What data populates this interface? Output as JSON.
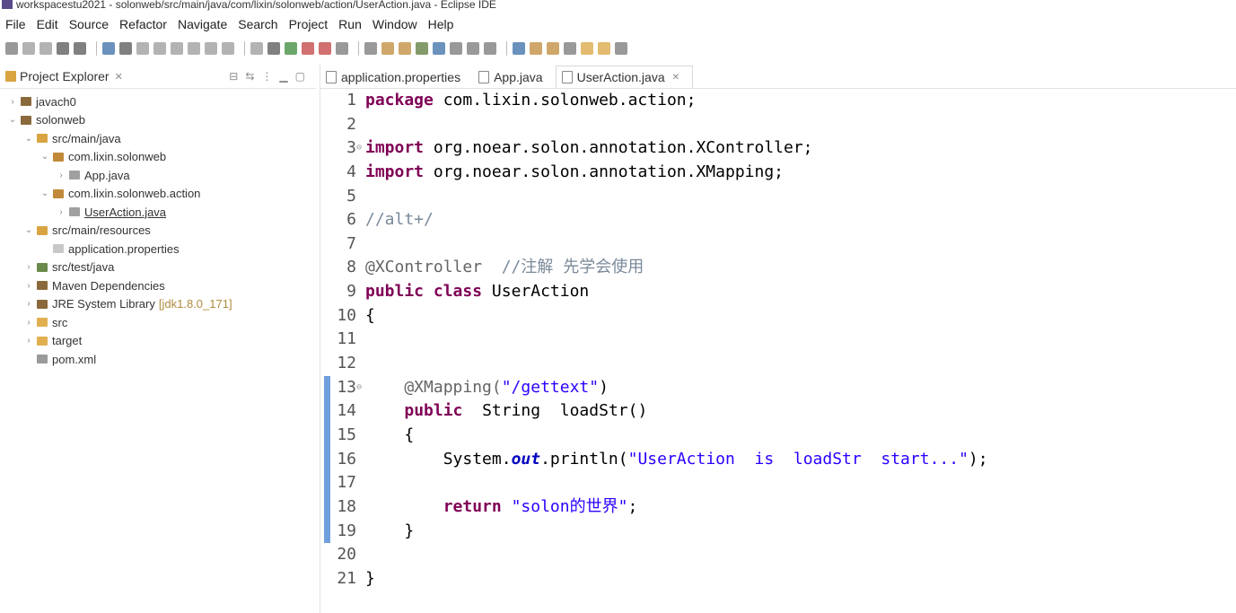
{
  "window": {
    "title": "workspacestu2021 - solonweb/src/main/java/com/lixin/solonweb/action/UserAction.java - Eclipse IDE"
  },
  "menu": [
    "File",
    "Edit",
    "Source",
    "Refactor",
    "Navigate",
    "Search",
    "Project",
    "Run",
    "Window",
    "Help"
  ],
  "explorer": {
    "title": "Project Explorer",
    "close_glyph": "✕",
    "tree": [
      {
        "label": "javach0",
        "indent": 0,
        "arrow": "›",
        "icon": "project-icon",
        "color": "#8a6a3c"
      },
      {
        "label": "solonweb",
        "indent": 0,
        "arrow": "⌄",
        "icon": "project-icon",
        "color": "#8a6a3c"
      },
      {
        "label": "src/main/java",
        "indent": 1,
        "arrow": "⌄",
        "icon": "source-folder-icon",
        "color": "#d9a441"
      },
      {
        "label": "com.lixin.solonweb",
        "indent": 2,
        "arrow": "⌄",
        "icon": "package-icon",
        "color": "#c08a3a"
      },
      {
        "label": "App.java",
        "indent": 3,
        "arrow": "›",
        "icon": "java-file-icon",
        "color": "#a0a0a0"
      },
      {
        "label": "com.lixin.solonweb.action",
        "indent": 2,
        "arrow": "⌄",
        "icon": "package-icon",
        "color": "#c08a3a"
      },
      {
        "label": "UserAction.java",
        "indent": 3,
        "arrow": "›",
        "icon": "java-file-icon",
        "color": "#a0a0a0",
        "selected": true
      },
      {
        "label": "src/main/resources",
        "indent": 1,
        "arrow": "⌄",
        "icon": "source-folder-icon",
        "color": "#d9a441"
      },
      {
        "label": "application.properties",
        "indent": 2,
        "arrow": "",
        "icon": "properties-file-icon",
        "color": "#c8c8c8"
      },
      {
        "label": "src/test/java",
        "indent": 1,
        "arrow": "›",
        "icon": "source-folder-icon",
        "color": "#6a8a4a"
      },
      {
        "label": "Maven Dependencies",
        "indent": 1,
        "arrow": "›",
        "icon": "library-icon",
        "color": "#8a6a3c"
      },
      {
        "label": "JRE System Library",
        "indent": 1,
        "arrow": "›",
        "icon": "library-icon",
        "color": "#8a6a3c",
        "extra": "[jdk1.8.0_171]"
      },
      {
        "label": "src",
        "indent": 1,
        "arrow": "›",
        "icon": "folder-icon",
        "color": "#e0b050"
      },
      {
        "label": "target",
        "indent": 1,
        "arrow": "›",
        "icon": "folder-icon",
        "color": "#e0b050"
      },
      {
        "label": "pom.xml",
        "indent": 1,
        "arrow": "",
        "icon": "xml-file-icon",
        "color": "#9a9a9a"
      }
    ]
  },
  "editor": {
    "tabs": [
      {
        "label": "application.properties",
        "active": false
      },
      {
        "label": "App.java",
        "active": false
      },
      {
        "label": "UserAction.java",
        "active": true
      }
    ],
    "tab_close_glyph": "✕",
    "lines": [
      {
        "n": "1",
        "tokens": [
          {
            "t": "package",
            "c": "kw"
          },
          {
            "t": " com.lixin.solonweb.action;",
            "c": ""
          }
        ]
      },
      {
        "n": "2",
        "tokens": []
      },
      {
        "n": "3",
        "fold": "⊖",
        "tokens": [
          {
            "t": "import",
            "c": "kw"
          },
          {
            "t": " org.noear.solon.annotation.XController;",
            "c": ""
          }
        ]
      },
      {
        "n": "4",
        "tokens": [
          {
            "t": "import",
            "c": "kw"
          },
          {
            "t": " org.noear.solon.annotation.XMapping;",
            "c": ""
          }
        ]
      },
      {
        "n": "5",
        "tokens": []
      },
      {
        "n": "6",
        "tokens": [
          {
            "t": "//alt+/",
            "c": "cm"
          }
        ]
      },
      {
        "n": "7",
        "tokens": []
      },
      {
        "n": "8",
        "tokens": [
          {
            "t": "@XController",
            "c": "ann"
          },
          {
            "t": "  //注解 先学会使用",
            "c": "cm"
          }
        ]
      },
      {
        "n": "9",
        "tokens": [
          {
            "t": "public",
            "c": "kw"
          },
          {
            "t": " ",
            "c": ""
          },
          {
            "t": "class",
            "c": "kw"
          },
          {
            "t": " UserAction",
            "c": ""
          }
        ]
      },
      {
        "n": "10",
        "tokens": [
          {
            "t": "{",
            "c": ""
          }
        ]
      },
      {
        "n": "11",
        "tokens": []
      },
      {
        "n": "12",
        "tokens": []
      },
      {
        "n": "13",
        "fold": "⊖",
        "marker": true,
        "tokens": [
          {
            "t": "    @XMapping(",
            "c": "ann"
          },
          {
            "t": "\"/gettext\"",
            "c": "str"
          },
          {
            "t": ")",
            "c": ""
          }
        ]
      },
      {
        "n": "14",
        "marker": true,
        "tokens": [
          {
            "t": "    ",
            "c": ""
          },
          {
            "t": "public",
            "c": "kw"
          },
          {
            "t": "  String  loadStr()",
            "c": ""
          }
        ]
      },
      {
        "n": "15",
        "marker": true,
        "tokens": [
          {
            "t": "    {",
            "c": ""
          }
        ]
      },
      {
        "n": "16",
        "marker": true,
        "tokens": [
          {
            "t": "        System.",
            "c": ""
          },
          {
            "t": "out",
            "c": "field"
          },
          {
            "t": ".println(",
            "c": ""
          },
          {
            "t": "\"UserAction  is  loadStr  start...\"",
            "c": "str"
          },
          {
            "t": ");",
            "c": ""
          }
        ]
      },
      {
        "n": "17",
        "marker": true,
        "tokens": []
      },
      {
        "n": "18",
        "marker": true,
        "tokens": [
          {
            "t": "        ",
            "c": ""
          },
          {
            "t": "return",
            "c": "kw"
          },
          {
            "t": " ",
            "c": ""
          },
          {
            "t": "\"solon的世界\"",
            "c": "str"
          },
          {
            "t": ";",
            "c": ""
          }
        ]
      },
      {
        "n": "19",
        "marker": true,
        "tokens": [
          {
            "t": "    }",
            "c": ""
          }
        ]
      },
      {
        "n": "20",
        "tokens": []
      },
      {
        "n": "21",
        "tokens": [
          {
            "t": "}",
            "c": ""
          }
        ]
      }
    ]
  }
}
